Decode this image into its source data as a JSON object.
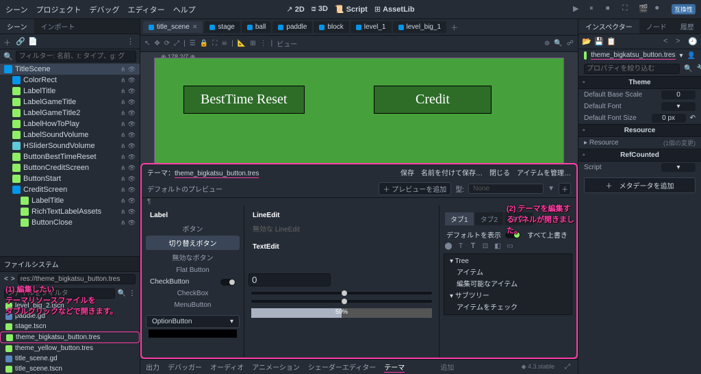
{
  "menu": [
    "シーン",
    "プロジェクト",
    "デバッグ",
    "エディター",
    "ヘルプ"
  ],
  "topbar_center": [
    "2D",
    "3D",
    "Script",
    "AssetLib"
  ],
  "compat": "互換性",
  "left_dock": {
    "tabs": [
      "シーン",
      "インポート"
    ],
    "filter_placeholder": "フィルター: 名前、t: タイプ、g: グ"
  },
  "scene_tree": [
    {
      "name": "TitleScene",
      "cls": "ic-blue",
      "sel": true
    },
    {
      "name": "ColorRect",
      "cls": "ic-blue",
      "ind": 1
    },
    {
      "name": "LabelTitle",
      "cls": "ic-green",
      "ind": 1
    },
    {
      "name": "LabelGameTitle",
      "cls": "ic-green",
      "ind": 1
    },
    {
      "name": "LabelGameTitle2",
      "cls": "ic-green",
      "ind": 1
    },
    {
      "name": "LabelHowToPlay",
      "cls": "ic-green",
      "ind": 1
    },
    {
      "name": "LabelSoundVolume",
      "cls": "ic-green",
      "ind": 1
    },
    {
      "name": "HSliderSoundVolume",
      "cls": "ic-cyan",
      "ind": 1
    },
    {
      "name": "ButtonBestTimeReset",
      "cls": "ic-green",
      "ind": 1
    },
    {
      "name": "ButtonCreditScreen",
      "cls": "ic-green",
      "ind": 1
    },
    {
      "name": "ButtonStart",
      "cls": "ic-green",
      "ind": 1
    },
    {
      "name": "CreditScreen",
      "cls": "ic-blue",
      "ind": 1
    },
    {
      "name": "LabelTitle",
      "cls": "ic-green",
      "ind": 2
    },
    {
      "name": "RichTextLabelAssets",
      "cls": "ic-green",
      "ind": 2
    },
    {
      "name": "ButtonClose",
      "cls": "ic-green",
      "ind": 2
    }
  ],
  "fs": {
    "header": "ファイルシステム",
    "path": "res://theme_bigkatsu_button.tres",
    "filter": "ファイルをフィルタ",
    "items": [
      {
        "name": "level_big_2.tscn",
        "ic": "res-icon"
      },
      {
        "name": "paddle.gd",
        "ic": "gd-icon"
      },
      {
        "name": "stage.tscn",
        "ic": "res-icon"
      },
      {
        "name": "theme_bigkatsu_button.tres",
        "ic": "res-icon",
        "hl": true
      },
      {
        "name": "theme_yellow_button.tres",
        "ic": "res-icon"
      },
      {
        "name": "title_scene.gd",
        "ic": "gd-icon"
      },
      {
        "name": "title_scene.tscn",
        "ic": "res-icon"
      }
    ]
  },
  "center_tabs": [
    "title_scene",
    "stage",
    "ball",
    "paddle",
    "block",
    "level_1",
    "level_big_1"
  ],
  "view_label": "ビュー",
  "ruler": "178.2/7",
  "game_buttons": [
    "BestTime Reset",
    "Credit"
  ],
  "annotations": {
    "a1": "(1) 編集したい\nテーマリソースファイルを\nダブルクリックなどで開きます。",
    "a2": "(2) テーマを編集するパネルが開きました。"
  },
  "theme": {
    "title_prefix": "テーマ：",
    "title": "theme_bigkatsu_button.tres",
    "actions": [
      "保存",
      "名前を付けて保存…",
      "閉じる",
      "アイテムを管理…"
    ],
    "default_preview": "デフォルトのプレビュー",
    "add_preview": "＋ プレビューを追加",
    "type_label": "型:",
    "type_val": "None",
    "col1": [
      "Label",
      "ボタン",
      "切り替えボタン",
      "無効なボタン",
      "Flat Button",
      "CheckButton",
      "CheckBox",
      "MenuButton",
      "OptionButton"
    ],
    "col2": {
      "lineedit": "LineEdit",
      "invalid_le": "無効な LineEdit",
      "textedit": "TextEdit",
      "spin_val": "0",
      "slider_label": "50%"
    },
    "col3": {
      "tabs": [
        "タブ1",
        "タブ2",
        "タブ3"
      ],
      "show_default": "デフォルトを表示",
      "override_all": "すべて上書き",
      "tree_label": "Tree",
      "items": [
        "アイテム",
        "編集可能なアイテム",
        "サブツリー",
        "アイテムをチェック"
      ]
    }
  },
  "bottom_tabs": [
    "出力",
    "デバッガー",
    "オーディオ",
    "アニメーション",
    "シェーダーエディター",
    "テーマ"
  ],
  "add_label": "追加",
  "version": "4.3.stable",
  "inspector": {
    "tabs": [
      "インスペクター",
      "ノード",
      "履歴"
    ],
    "resource": "theme_bigkatsu_button.tres",
    "filter": "プロパティを絞り込む",
    "sections": {
      "theme": "Theme",
      "resource": "Resource",
      "refcounted": "RefCounted"
    },
    "props": [
      {
        "n": "Default Base Scale",
        "v": "0"
      },
      {
        "n": "Default Font",
        "v": ""
      },
      {
        "n": "Default Font Size",
        "v": "0 px"
      }
    ],
    "resource_info": "(1個の変更)",
    "resource_prop": "Resource",
    "script_prop": "Script",
    "add_meta": "＋　メタデータを追加"
  }
}
